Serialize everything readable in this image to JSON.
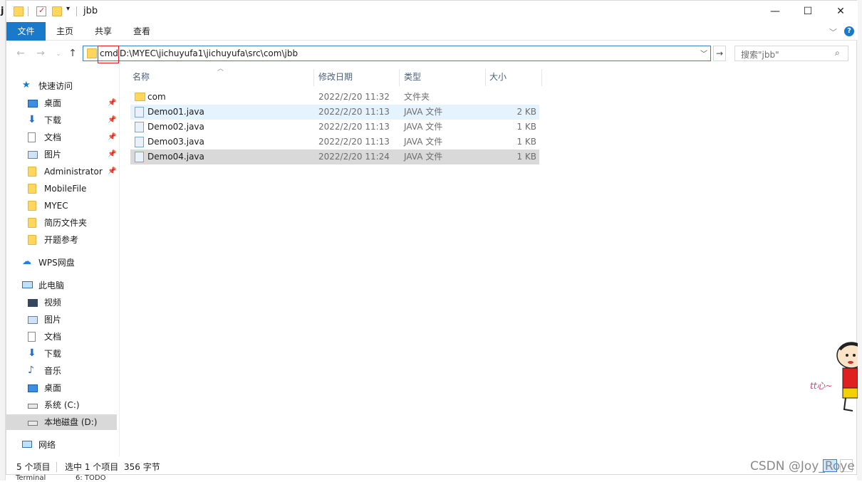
{
  "window": {
    "title": "jbb",
    "left_cut_letter": "j",
    "controls": {
      "minimize": "—",
      "maximize": "☐",
      "close": "✕"
    }
  },
  "ribbon": {
    "tabs": [
      "文件",
      "主页",
      "共享",
      "查看"
    ]
  },
  "address": {
    "typed": "cmd",
    "path": "D:\\MYEC\\jichuyufa1\\jichuyufa\\src\\com\\jbb",
    "search_placeholder": "搜索\"jbb\""
  },
  "nav": {
    "quick_access": "快速访问",
    "pinned": [
      "桌面",
      "下载",
      "文档",
      "图片",
      "Administrator"
    ],
    "folders": [
      "MobileFile",
      "MYEC",
      "简历文件夹",
      "开题参考"
    ],
    "wps": "WPS网盘",
    "this_pc": "此电脑",
    "pc_items": [
      "视频",
      "图片",
      "文档",
      "下载",
      "音乐",
      "桌面",
      "系统 (C:)",
      "本地磁盘 (D:)"
    ],
    "network": "网络"
  },
  "columns": {
    "name": "名称",
    "date": "修改日期",
    "type": "类型",
    "size": "大小"
  },
  "files": [
    {
      "name": "com",
      "date": "2022/2/20 11:32",
      "type": "文件夹",
      "size": "",
      "kind": "folder"
    },
    {
      "name": "Demo01.java",
      "date": "2022/2/20 11:13",
      "type": "JAVA 文件",
      "size": "2 KB",
      "kind": "file"
    },
    {
      "name": "Demo02.java",
      "date": "2022/2/20 11:13",
      "type": "JAVA 文件",
      "size": "1 KB",
      "kind": "file"
    },
    {
      "name": "Demo03.java",
      "date": "2022/2/20 11:13",
      "type": "JAVA 文件",
      "size": "1 KB",
      "kind": "file"
    },
    {
      "name": "Demo04.java",
      "date": "2022/2/20 11:24",
      "type": "JAVA 文件",
      "size": "1 KB",
      "kind": "file"
    }
  ],
  "status": {
    "count": "5 个项目",
    "selected": "选中 1 个项目",
    "bytes": "356 字节"
  },
  "watermark": "CSDN @Joy_Roye",
  "bottom_tools": [
    "Terminal",
    "6: TODO"
  ],
  "sticker_text": "tt心~",
  "colors": {
    "accent": "#1979ca",
    "selected_row": "#d9d9d9",
    "hover_row": "#e5f3ff",
    "cmd_border": "#e02020"
  }
}
